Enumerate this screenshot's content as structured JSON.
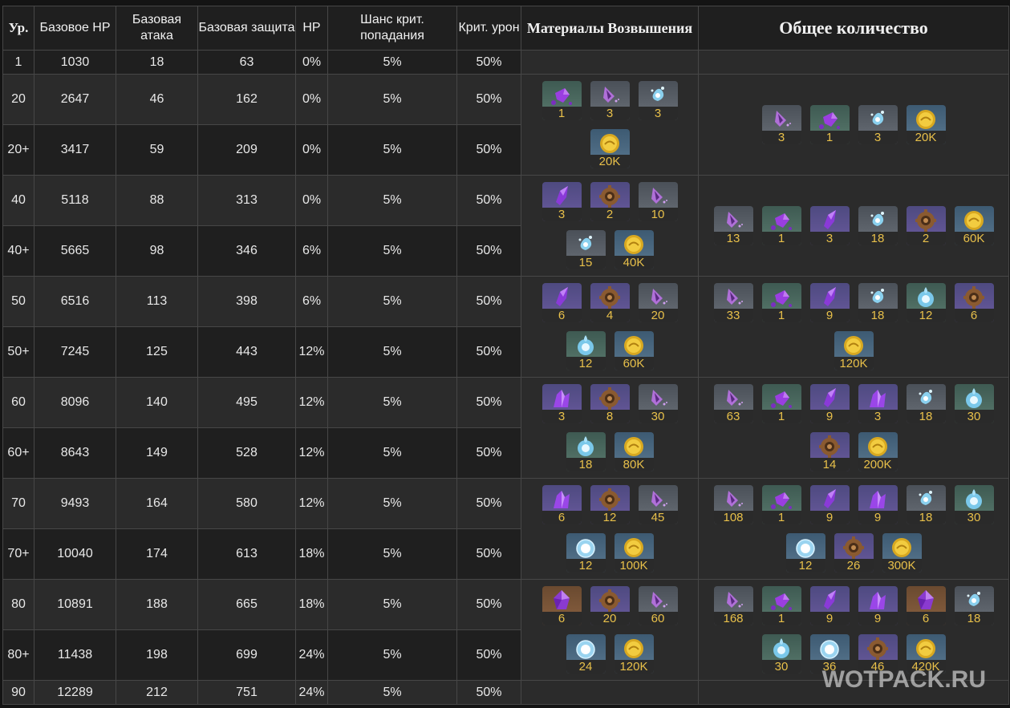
{
  "headers": [
    "Ур.",
    "Базовое HP",
    "Базовая атака",
    "Базовая защита",
    "HP",
    "Шанс крит. попадания",
    "Крит. урон",
    "Материалы Возвышения",
    "Общее количество"
  ],
  "rows": [
    [
      "1",
      "1030",
      "18",
      "63",
      "0%",
      "5%",
      "50%"
    ],
    [
      "20",
      "2647",
      "46",
      "162",
      "0%",
      "5%",
      "50%"
    ],
    [
      "20+",
      "3417",
      "59",
      "209",
      "0%",
      "5%",
      "50%"
    ],
    [
      "40",
      "5118",
      "88",
      "313",
      "0%",
      "5%",
      "50%"
    ],
    [
      "40+",
      "5665",
      "98",
      "346",
      "6%",
      "5%",
      "50%"
    ],
    [
      "50",
      "6516",
      "113",
      "398",
      "6%",
      "5%",
      "50%"
    ],
    [
      "50+",
      "7245",
      "125",
      "443",
      "12%",
      "5%",
      "50%"
    ],
    [
      "60",
      "8096",
      "140",
      "495",
      "12%",
      "5%",
      "50%"
    ],
    [
      "60+",
      "8643",
      "149",
      "528",
      "12%",
      "5%",
      "50%"
    ],
    [
      "70",
      "9493",
      "164",
      "580",
      "12%",
      "5%",
      "50%"
    ],
    [
      "70+",
      "10040",
      "174",
      "613",
      "18%",
      "5%",
      "50%"
    ],
    [
      "80",
      "10891",
      "188",
      "665",
      "18%",
      "5%",
      "50%"
    ],
    [
      "80+",
      "11438",
      "198",
      "699",
      "24%",
      "5%",
      "50%"
    ],
    [
      "90",
      "12289",
      "212",
      "751",
      "24%",
      "5%",
      "50%"
    ]
  ],
  "ascensions": [
    {
      "materials": [
        {
          "icon": "purple-gem-icon",
          "count": "1"
        },
        {
          "icon": "purple-flower-icon",
          "count": "3"
        },
        {
          "icon": "blue-spirit-icon",
          "count": "3"
        },
        {
          "icon": "gold-coin-icon",
          "count": "20K"
        }
      ],
      "total": [
        {
          "icon": "purple-flower-icon",
          "count": "3"
        },
        {
          "icon": "purple-gem-icon",
          "count": "1"
        },
        {
          "icon": "blue-spirit-icon",
          "count": "3"
        },
        {
          "icon": "gold-coin-icon",
          "count": "20K"
        }
      ]
    },
    {
      "materials": [
        {
          "icon": "purple-shard-icon",
          "count": "3"
        },
        {
          "icon": "bronze-gear-icon",
          "count": "2"
        },
        {
          "icon": "purple-flower-icon",
          "count": "10"
        },
        {
          "icon": "blue-spirit-icon",
          "count": "15"
        },
        {
          "icon": "gold-coin-icon",
          "count": "40K"
        }
      ],
      "total": [
        {
          "icon": "purple-flower-icon",
          "count": "13"
        },
        {
          "icon": "purple-gem-icon",
          "count": "1"
        },
        {
          "icon": "purple-shard-icon",
          "count": "3"
        },
        {
          "icon": "blue-spirit-icon",
          "count": "18"
        },
        {
          "icon": "bronze-gear-icon",
          "count": "2"
        },
        {
          "icon": "gold-coin-icon",
          "count": "60K"
        }
      ]
    },
    {
      "materials": [
        {
          "icon": "purple-shard-icon",
          "count": "6"
        },
        {
          "icon": "bronze-gear-icon",
          "count": "4"
        },
        {
          "icon": "purple-flower-icon",
          "count": "20"
        },
        {
          "icon": "blue-orb-icon",
          "count": "12"
        },
        {
          "icon": "gold-coin-icon",
          "count": "60K"
        }
      ],
      "total": [
        {
          "icon": "purple-flower-icon",
          "count": "33"
        },
        {
          "icon": "purple-gem-icon",
          "count": "1"
        },
        {
          "icon": "purple-shard-icon",
          "count": "9"
        },
        {
          "icon": "blue-spirit-icon",
          "count": "18"
        },
        {
          "icon": "blue-orb-icon",
          "count": "12"
        },
        {
          "icon": "bronze-gear-icon",
          "count": "6"
        },
        {
          "icon": "gold-coin-icon",
          "count": "120K"
        }
      ]
    },
    {
      "materials": [
        {
          "icon": "purple-crystal-icon",
          "count": "3"
        },
        {
          "icon": "bronze-gear-icon",
          "count": "8"
        },
        {
          "icon": "purple-flower-icon",
          "count": "30"
        },
        {
          "icon": "blue-orb-icon",
          "count": "18"
        },
        {
          "icon": "gold-coin-icon",
          "count": "80K"
        }
      ],
      "total": [
        {
          "icon": "purple-flower-icon",
          "count": "63"
        },
        {
          "icon": "purple-gem-icon",
          "count": "1"
        },
        {
          "icon": "purple-shard-icon",
          "count": "9"
        },
        {
          "icon": "purple-crystal-icon",
          "count": "3"
        },
        {
          "icon": "blue-spirit-icon",
          "count": "18"
        },
        {
          "icon": "blue-orb-icon",
          "count": "30"
        },
        {
          "icon": "bronze-gear-icon",
          "count": "14"
        },
        {
          "icon": "gold-coin-icon",
          "count": "200K"
        }
      ]
    },
    {
      "materials": [
        {
          "icon": "purple-crystal-icon",
          "count": "6"
        },
        {
          "icon": "bronze-gear-icon",
          "count": "12"
        },
        {
          "icon": "purple-flower-icon",
          "count": "45"
        },
        {
          "icon": "white-orb-icon",
          "count": "12"
        },
        {
          "icon": "gold-coin-icon",
          "count": "100K"
        }
      ],
      "total": [
        {
          "icon": "purple-flower-icon",
          "count": "108"
        },
        {
          "icon": "purple-gem-icon",
          "count": "1"
        },
        {
          "icon": "purple-shard-icon",
          "count": "9"
        },
        {
          "icon": "purple-crystal-icon",
          "count": "9"
        },
        {
          "icon": "blue-spirit-icon",
          "count": "18"
        },
        {
          "icon": "blue-orb-icon",
          "count": "30"
        },
        {
          "icon": "white-orb-icon",
          "count": "12"
        },
        {
          "icon": "bronze-gear-icon",
          "count": "26"
        },
        {
          "icon": "gold-coin-icon",
          "count": "300K"
        }
      ]
    },
    {
      "materials": [
        {
          "icon": "amethyst-gem-icon",
          "count": "6"
        },
        {
          "icon": "bronze-gear-icon",
          "count": "20"
        },
        {
          "icon": "purple-flower-icon",
          "count": "60"
        },
        {
          "icon": "white-orb-icon",
          "count": "24"
        },
        {
          "icon": "gold-coin-icon",
          "count": "120K"
        }
      ],
      "total": [
        {
          "icon": "purple-flower-icon",
          "count": "168"
        },
        {
          "icon": "purple-gem-icon",
          "count": "1"
        },
        {
          "icon": "purple-shard-icon",
          "count": "9"
        },
        {
          "icon": "purple-crystal-icon",
          "count": "9"
        },
        {
          "icon": "amethyst-gem-icon",
          "count": "6"
        },
        {
          "icon": "blue-spirit-icon",
          "count": "18"
        },
        {
          "icon": "blue-orb-icon",
          "count": "30"
        },
        {
          "icon": "white-orb-icon",
          "count": "36"
        },
        {
          "icon": "bronze-gear-icon",
          "count": "46"
        },
        {
          "icon": "gold-coin-icon",
          "count": "420K"
        }
      ]
    }
  ],
  "watermark": "WOTPACK.RU",
  "colors": {
    "count_text": "#e8c04a",
    "border": "#474747",
    "row_dark": "#1f1f1f",
    "row_light": "#2b2b2b"
  }
}
